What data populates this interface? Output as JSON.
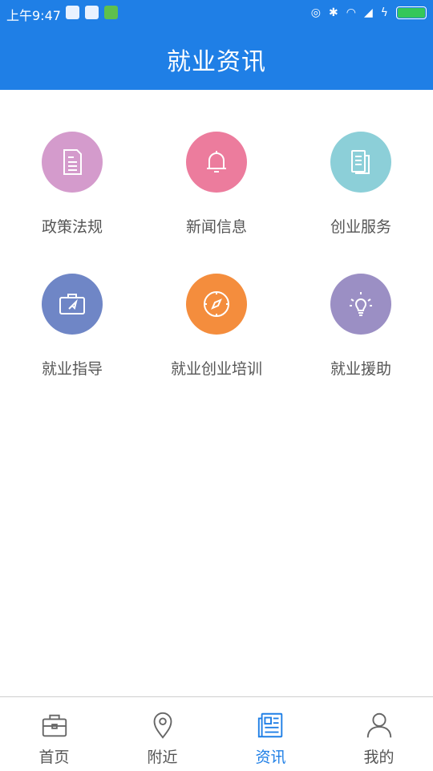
{
  "status_bar": {
    "time": "上午9:47"
  },
  "header": {
    "title": "就业资讯"
  },
  "grid": {
    "items": [
      {
        "label": "政策法规",
        "icon": "document-icon",
        "color": "#d49bcc"
      },
      {
        "label": "新闻信息",
        "icon": "bell-icon",
        "color": "#ec7c9d"
      },
      {
        "label": "创业服务",
        "icon": "papers-icon",
        "color": "#8ccfd8"
      },
      {
        "label": "就业指导",
        "icon": "briefcase-arrow-icon",
        "color": "#6f86c6"
      },
      {
        "label": "就业创业培训",
        "icon": "compass-icon",
        "color": "#f48d3d"
      },
      {
        "label": "就业援助",
        "icon": "lightbulb-icon",
        "color": "#9b8fc4"
      }
    ]
  },
  "tabbar": {
    "tabs": [
      {
        "label": "首页",
        "icon": "briefcase-icon"
      },
      {
        "label": "附近",
        "icon": "location-pin-icon"
      },
      {
        "label": "资讯",
        "icon": "news-icon",
        "active": true
      },
      {
        "label": "我的",
        "icon": "user-icon"
      }
    ],
    "active_color": "#1f7fe6"
  },
  "colors": {
    "header": "#1f7fe6"
  }
}
